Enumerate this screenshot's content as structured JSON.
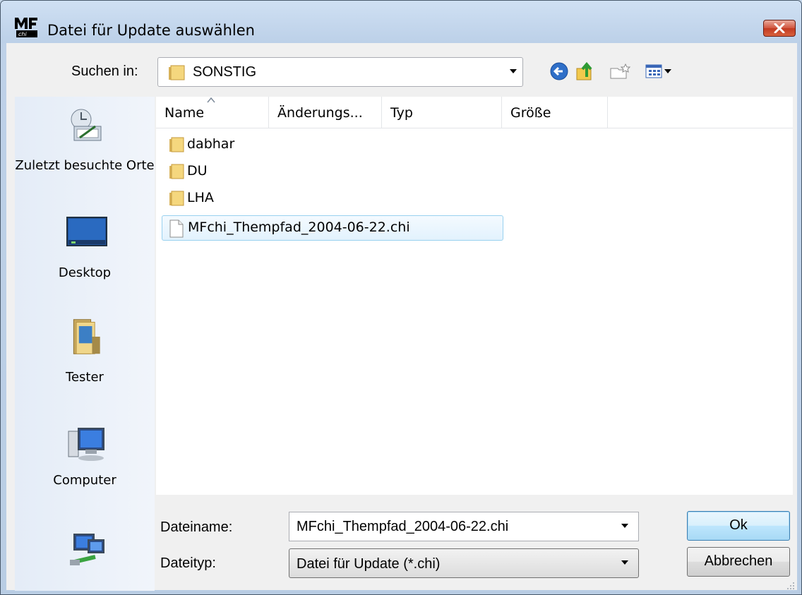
{
  "window": {
    "title": "Datei für Update auswählen"
  },
  "lookin": {
    "label": "Suchen in:",
    "value": "SONSTIG"
  },
  "toolbar": {
    "back_icon": "back-arrow-icon",
    "up_icon": "up-folder-icon",
    "new_folder_icon": "new-folder-icon",
    "view_icon": "view-menu-icon"
  },
  "places": [
    {
      "label": "Zuletzt besuchte Orte",
      "icon": "recent-places-icon"
    },
    {
      "label": "Desktop",
      "icon": "desktop-icon"
    },
    {
      "label": "Tester",
      "icon": "user-folder-icon"
    },
    {
      "label": "Computer",
      "icon": "computer-icon"
    },
    {
      "label": "",
      "icon": "network-icon"
    }
  ],
  "columns": [
    "Name",
    "Änderungs...",
    "Typ",
    "Größe"
  ],
  "files": [
    {
      "name": "dabhar",
      "type": "folder"
    },
    {
      "name": "DU",
      "type": "folder"
    },
    {
      "name": "LHA",
      "type": "folder"
    },
    {
      "name": "MFchi_Thempfad_2004-06-22.chi",
      "type": "file",
      "selected": true
    }
  ],
  "filename": {
    "label": "Dateiname:",
    "value": "MFchi_Thempfad_2004-06-22.chi"
  },
  "filetype": {
    "label": "Dateityp:",
    "value": "Datei für Update (*.chi)"
  },
  "buttons": {
    "ok": "Ok",
    "cancel": "Abbrechen"
  },
  "colors": {
    "selection_border": "#99d1ef",
    "title_bg": "#bfd3eb",
    "close_red": "#c8432a"
  }
}
